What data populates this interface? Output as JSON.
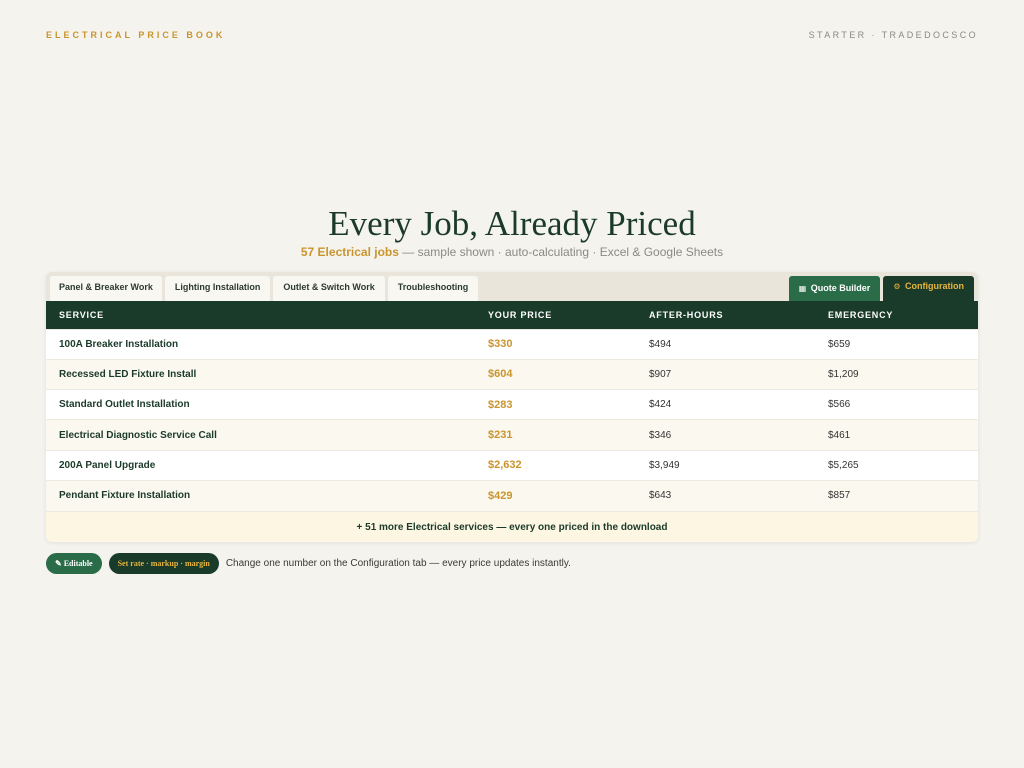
{
  "header": {
    "brand": "ELECTRICAL PRICE BOOK",
    "tier": "STARTER · TRADEDOCSCO"
  },
  "hero": {
    "headline": "Every Job, Already Priced",
    "count": "57 Electrical jobs",
    "subtitle": " — sample shown · auto-calculating · Excel & Google Sheets"
  },
  "tabs": [
    {
      "label": "Panel & Breaker Work"
    },
    {
      "label": "Lighting Installation"
    },
    {
      "label": "Outlet & Switch Work"
    },
    {
      "label": "Troubleshooting"
    }
  ],
  "right_tabs": {
    "quote": {
      "icon": "▦",
      "label": "Quote Builder"
    },
    "config": {
      "icon": "⚙",
      "label": "Configuration"
    }
  },
  "table": {
    "columns": [
      "SERVICE",
      "YOUR PRICE",
      "AFTER-HOURS",
      "EMERGENCY"
    ],
    "rows": [
      {
        "service": "100A Breaker Installation",
        "price": "$330",
        "after": "$494",
        "emergency": "$659"
      },
      {
        "service": "Recessed LED Fixture Install",
        "price": "$604",
        "after": "$907",
        "emergency": "$1,209"
      },
      {
        "service": "Standard Outlet Installation",
        "price": "$283",
        "after": "$424",
        "emergency": "$566"
      },
      {
        "service": "Electrical Diagnostic Service Call",
        "price": "$231",
        "after": "$346",
        "emergency": "$461"
      },
      {
        "service": "200A Panel Upgrade",
        "price": "$2,632",
        "after": "$3,949",
        "emergency": "$5,265"
      },
      {
        "service": "Pendant Fixture Installation",
        "price": "$429",
        "after": "$643",
        "emergency": "$857"
      }
    ],
    "more": "+ 51 more Electrical services — every one priced in the download"
  },
  "footer": {
    "editable": "✎ Editable",
    "rate": "Set rate · markup · margin",
    "note": "Change one number on the Configuration tab — every price updates instantly."
  },
  "colors": {
    "brand_green": "#1a3a2a",
    "accent_gold": "#c9952f",
    "tab_green": "#2a6b48",
    "background": "#f5f3ee"
  }
}
